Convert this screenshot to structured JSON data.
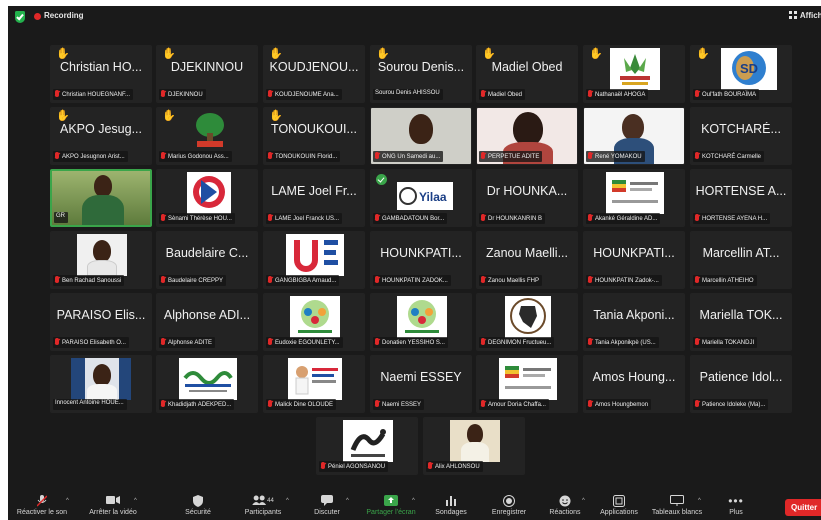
{
  "topbar": {
    "recording_label": "Recording",
    "view_label": "Affiche"
  },
  "tiles": {
    "t1": {
      "big": "Christian HO...",
      "cap": "Christian HOUEGNANF..."
    },
    "t2": {
      "big": "DJEKINNOU",
      "cap": "DJEKINNOU"
    },
    "t3": {
      "big": "KOUDJENOU...",
      "cap": "KOUDJENOUME Ana..."
    },
    "t4": {
      "big": "Sourou Denis...",
      "cap": "Sourou Denis AHISSOU"
    },
    "t5": {
      "big": "Madiel Obed",
      "cap": "Madiel Obed"
    },
    "t6": {
      "cap": "Nathanaël AHOGA"
    },
    "t7": {
      "cap": "Oul'fath BOURAÏMA",
      "logo_text": "SD"
    },
    "t8": {
      "big": "AKPO Jesug...",
      "cap": "AKPO Jesugnon Arist..."
    },
    "t9": {
      "cap": "Marius Godonou Ass..."
    },
    "t10": {
      "big": "TONOUKOUI...",
      "cap": "TONOUKOUIN Florid..."
    },
    "t11": {
      "cap": "ONG Un Samedi au..."
    },
    "t12": {
      "cap": "PERPETUE ADITE"
    },
    "t13": {
      "cap": "René YOMAKOU"
    },
    "t14": {
      "big": "KOTCHARÉ...",
      "cap": "KOTCHARÉ Carmelle"
    },
    "t15": {
      "cap": "GR"
    },
    "t16": {
      "cap": "Sènami Thérèse HOU..."
    },
    "t17": {
      "big": "LAME Joel Fr...",
      "cap": "LAME Joel Franck US..."
    },
    "t18": {
      "cap": "GAMBADATOUN Bor...",
      "logo_text": "Yilaa"
    },
    "t19": {
      "big": "Dr HOUNKA...",
      "cap": "Dr HOUNKANRIN B"
    },
    "t20": {
      "cap": "Akanké Géraldine AD..."
    },
    "t21": {
      "big": "HORTENSE A...",
      "cap": "HORTENSE AYENA H..."
    },
    "t22": {
      "cap": "Ben Rachad Sanoussi"
    },
    "t23": {
      "big": "Baudelaire C...",
      "cap": "Baudelaire CREPPY"
    },
    "t24": {
      "cap": "GANGBIGBA Arnaud..."
    },
    "t25": {
      "big": "HOUNKPATI...",
      "cap": "HOUNKPATIN ZADOK..."
    },
    "t26": {
      "big": "Zanou Maelli...",
      "cap": "Zanou Maellis FHP"
    },
    "t27": {
      "big": "HOUNKPATI...",
      "cap": "HOUNKPATIN Zadok-..."
    },
    "t28": {
      "big": "Marcellin AT...",
      "cap": "Marcellin ATHEIHO"
    },
    "t29": {
      "big": "PARAISO Elis...",
      "cap": "PARAISO Elisabeth O..."
    },
    "t30": {
      "big": "Alphonse ADI...",
      "cap": "Alphonse ADITE"
    },
    "t31": {
      "cap": "Eudoxie EGOUNLETY..."
    },
    "t32": {
      "cap": "Donatien YESSIHO S..."
    },
    "t33": {
      "cap": "DEGNIMON Fructueu..."
    },
    "t34": {
      "big": "Tania Akponi...",
      "cap": "Tania Akponikpè (US..."
    },
    "t35": {
      "big": "Mariella TOK...",
      "cap": "Mariella TOKANDJI"
    },
    "t36": {
      "cap": "Innocent Antoine HOUE..."
    },
    "t37": {
      "cap": "Khadidjath ADEKPED..."
    },
    "t38": {
      "cap": "Malick Dine OLOUDE"
    },
    "t39": {
      "big": "Naemi ESSEY",
      "cap": "Naemi ESSEY"
    },
    "t40": {
      "cap": "Amour Doria Chaffa..."
    },
    "t41": {
      "big": "Amos Houng...",
      "cap": "Amos Houngbemon"
    },
    "t42": {
      "big": "Patience Idol...",
      "cap": "Patience Idoleke (Ma)..."
    },
    "t43": {
      "cap": "Péniel AGONSANOU"
    },
    "t44": {
      "cap": "Alix AHLONSOU"
    }
  },
  "toolbar": {
    "unmute": "Réactiver le son",
    "video": "Arrêter la vidéo",
    "security": "Sécurité",
    "participants": "Participants",
    "participants_count": "44",
    "chat": "Discuter",
    "share": "Partager l'écran",
    "polls": "Sondages",
    "record": "Enregistrer",
    "reactions": "Réactions",
    "apps": "Applications",
    "whiteboards": "Tableaux blancs",
    "more": "Plus",
    "quit": "Quitter"
  },
  "colors": {
    "accent_green": "#3aa54a",
    "recording_red": "#e02828",
    "tile_bg": "#232323"
  }
}
